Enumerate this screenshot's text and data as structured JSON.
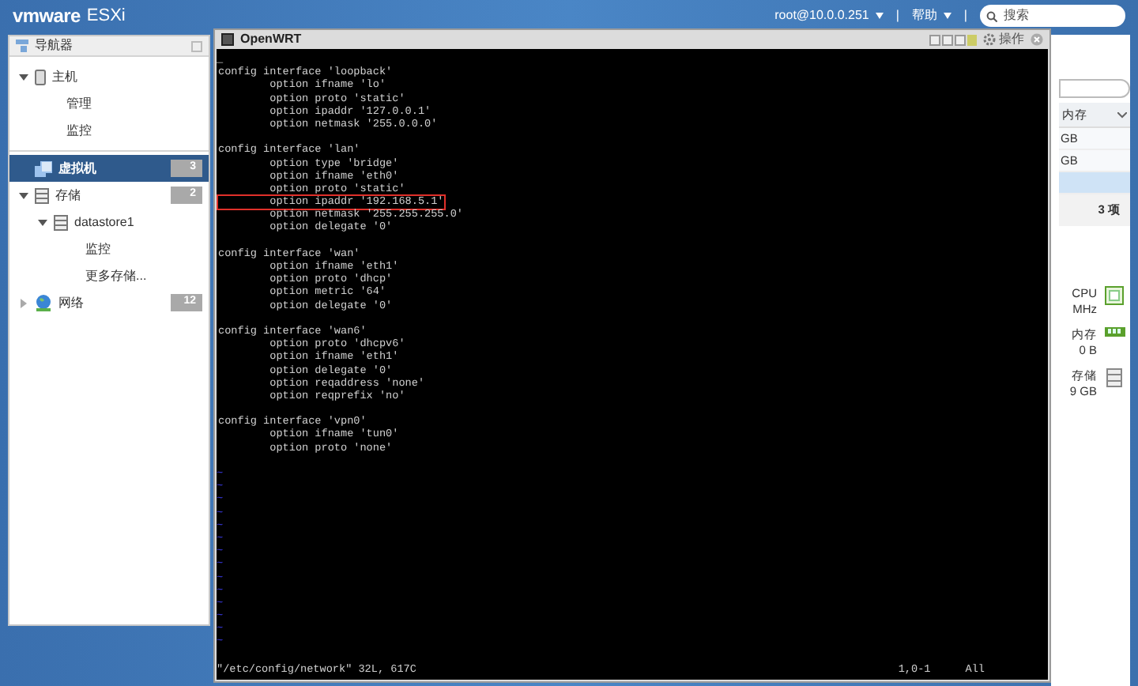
{
  "top_bar": {
    "logo": "vmware",
    "product": "ESXi",
    "user_menu": "root@10.0.0.251",
    "help_menu": "帮助",
    "separator": "|",
    "search": {
      "placeholder": "搜索"
    }
  },
  "navigator": {
    "title": "导航器",
    "items": [
      {
        "label": "主机",
        "kind": "host",
        "expanded": true,
        "selected": false,
        "children": [
          {
            "label": "管理",
            "selected": false
          },
          {
            "label": "监控",
            "selected": false
          }
        ]
      },
      {
        "label": "虚拟机",
        "kind": "vm",
        "selected": true,
        "badge": "3"
      },
      {
        "label": "存储",
        "kind": "storage",
        "expanded": true,
        "selected": false,
        "badge": "2",
        "children": [
          {
            "label": "datastore1",
            "kind": "storage",
            "expanded": true,
            "selected": false,
            "children": [
              {
                "label": "监控",
                "selected": false
              },
              {
                "label": "更多存储...",
                "selected": false
              }
            ]
          }
        ]
      },
      {
        "label": "网络",
        "kind": "network",
        "expanded": false,
        "selected": false,
        "badge": "12"
      }
    ]
  },
  "console": {
    "title": "OpenWRT",
    "actions_label": "操作",
    "cursor": "_",
    "blocks": [
      {
        "lines": [
          {
            "text": "config interface 'loopback'",
            "highlighted": false
          },
          {
            "text": "        option ifname 'lo'",
            "highlighted": false
          },
          {
            "text": "        option proto 'static'",
            "highlighted": false
          },
          {
            "text": "        option ipaddr '127.0.0.1'",
            "highlighted": false
          },
          {
            "text": "        option netmask '255.0.0.0'",
            "highlighted": false
          }
        ]
      },
      {
        "lines": [
          {
            "text": "config interface 'lan'",
            "highlighted": false
          },
          {
            "text": "        option type 'bridge'",
            "highlighted": false
          },
          {
            "text": "        option ifname 'eth0'",
            "highlighted": false
          },
          {
            "text": "        option proto 'static'",
            "highlighted": false
          },
          {
            "text": "        option ipaddr '192.168.5.1'",
            "highlighted": true
          },
          {
            "text": "        option netmask '255.255.255.0'",
            "highlighted": false
          },
          {
            "text": "        option delegate '0'",
            "highlighted": false
          }
        ]
      },
      {
        "lines": [
          {
            "text": "config interface 'wan'",
            "highlighted": false
          },
          {
            "text": "        option ifname 'eth1'",
            "highlighted": false
          },
          {
            "text": "        option proto 'dhcp'",
            "highlighted": false
          },
          {
            "text": "        option metric '64'",
            "highlighted": false
          },
          {
            "text": "        option delegate '0'",
            "highlighted": false
          }
        ]
      },
      {
        "lines": [
          {
            "text": "config interface 'wan6'",
            "highlighted": false
          },
          {
            "text": "        option proto 'dhcpv6'",
            "highlighted": false
          },
          {
            "text": "        option ifname 'eth1'",
            "highlighted": false
          },
          {
            "text": "        option delegate '0'",
            "highlighted": false
          },
          {
            "text": "        option reqaddress 'none'",
            "highlighted": false
          },
          {
            "text": "        option reqprefix 'no'",
            "highlighted": false
          }
        ]
      },
      {
        "lines": [
          {
            "text": "config interface 'vpn0'",
            "highlighted": false
          },
          {
            "text": "        option ifname 'tun0'",
            "highlighted": false
          },
          {
            "text": "        option proto 'none'",
            "highlighted": false
          }
        ]
      }
    ],
    "tilde_lines": [
      "~",
      "~",
      "~",
      "~",
      "~",
      "~",
      "~",
      "~",
      "~",
      "~",
      "~",
      "~",
      "~",
      "~"
    ],
    "status_file": "\"/etc/config/network\" 32L, 617C",
    "status_position": "1,0-1",
    "status_scroll": "All"
  },
  "background_panel": {
    "column_header": "内存",
    "rows": [
      {
        "text": "GB",
        "selected": false
      },
      {
        "text": "GB",
        "selected": false
      },
      {
        "selected": true
      }
    ],
    "count": "3 项",
    "resources": [
      {
        "kind": "cpu",
        "label": "CPU",
        "value": "MHz"
      },
      {
        "kind": "memory",
        "label": "内存",
        "value": "0 B"
      },
      {
        "kind": "storage",
        "label": "存储",
        "value": "9 GB"
      }
    ]
  }
}
